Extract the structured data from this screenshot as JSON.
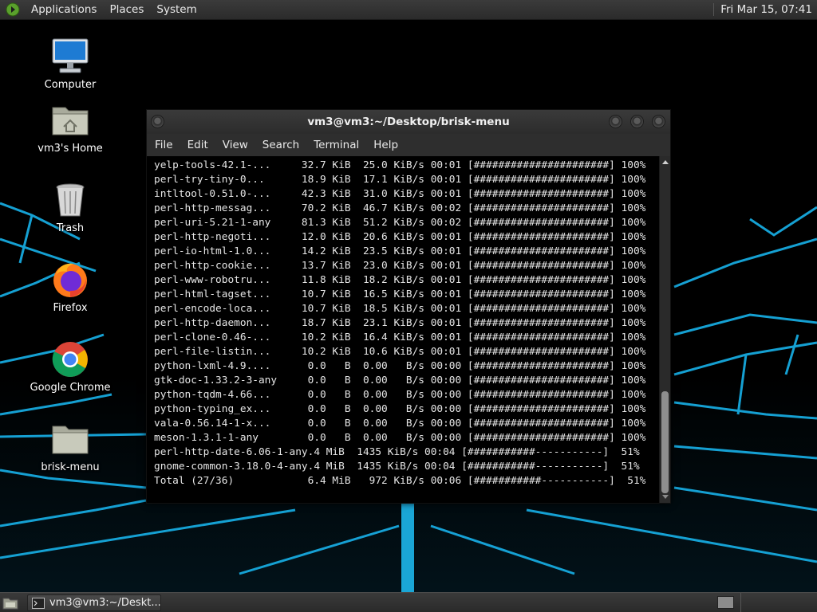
{
  "top_panel": {
    "menus": [
      "Applications",
      "Places",
      "System"
    ],
    "clock": "Fri Mar 15, 07:41"
  },
  "desktop": {
    "icons": [
      {
        "label": "Computer",
        "icon": "computer-icon"
      },
      {
        "label": "vm3's Home",
        "icon": "home-folder-icon"
      },
      {
        "label": "Trash",
        "icon": "trash-icon"
      },
      {
        "label": "Firefox",
        "icon": "firefox-icon"
      },
      {
        "label": "Google Chrome",
        "icon": "chrome-icon"
      },
      {
        "label": "brisk-menu",
        "icon": "folder-icon"
      }
    ]
  },
  "terminal": {
    "title": "vm3@vm3:~/Desktop/brisk-menu",
    "menus": [
      "File",
      "Edit",
      "View",
      "Search",
      "Terminal",
      "Help"
    ],
    "lines": [
      "yelp-tools-42.1-...     32.7 KiB  25.0 KiB/s 00:01 [######################] 100%",
      "perl-try-tiny-0...      18.9 KiB  17.1 KiB/s 00:01 [######################] 100%",
      "intltool-0.51.0-...     42.3 KiB  31.0 KiB/s 00:01 [######################] 100%",
      "perl-http-messag...     70.2 KiB  46.7 KiB/s 00:02 [######################] 100%",
      "perl-uri-5.21-1-any     81.3 KiB  51.2 KiB/s 00:02 [######################] 100%",
      "perl-http-negoti...     12.0 KiB  20.6 KiB/s 00:01 [######################] 100%",
      "perl-io-html-1.0...     14.2 KiB  23.5 KiB/s 00:01 [######################] 100%",
      "perl-http-cookie...     13.7 KiB  23.0 KiB/s 00:01 [######################] 100%",
      "perl-www-robotru...     11.8 KiB  18.2 KiB/s 00:01 [######################] 100%",
      "perl-html-tagset...     10.7 KiB  16.5 KiB/s 00:01 [######################] 100%",
      "perl-encode-loca...     10.7 KiB  18.5 KiB/s 00:01 [######################] 100%",
      "perl-http-daemon...     18.7 KiB  23.1 KiB/s 00:01 [######################] 100%",
      "perl-clone-0.46-...     10.2 KiB  16.4 KiB/s 00:01 [######################] 100%",
      "perl-file-listin...     10.2 KiB  10.6 KiB/s 00:01 [######################] 100%",
      "python-lxml-4.9....      0.0   B  0.00   B/s 00:00 [######################] 100%",
      "gtk-doc-1.33.2-3-any     0.0   B  0.00   B/s 00:00 [######################] 100%",
      "python-tqdm-4.66...      0.0   B  0.00   B/s 00:00 [######################] 100%",
      "python-typing_ex...      0.0   B  0.00   B/s 00:00 [######################] 100%",
      "vala-0.56.14-1-x...      0.0   B  0.00   B/s 00:00 [######################] 100%",
      "meson-1.3.1-1-any        0.0   B  0.00   B/s 00:00 [######################] 100%",
      "perl-http-date-6.06-1-any.4 MiB  1435 KiB/s 00:04 [###########-----------]  51%",
      "gnome-common-3.18.0-4-any.4 MiB  1435 KiB/s 00:04 [###########-----------]  51%",
      "Total (27/36)            6.4 MiB   972 KiB/s 00:06 [###########-----------]  51%"
    ],
    "scroll_position": 0.95
  },
  "bottom_panel": {
    "task_label": "vm3@vm3:~/Deskt..."
  },
  "colors": {
    "panel": "#2f2f2f",
    "terminal_bg": "#000000",
    "terminal_fg": "#e6e6e6",
    "wallpaper_accent": "#1aa6d6"
  }
}
